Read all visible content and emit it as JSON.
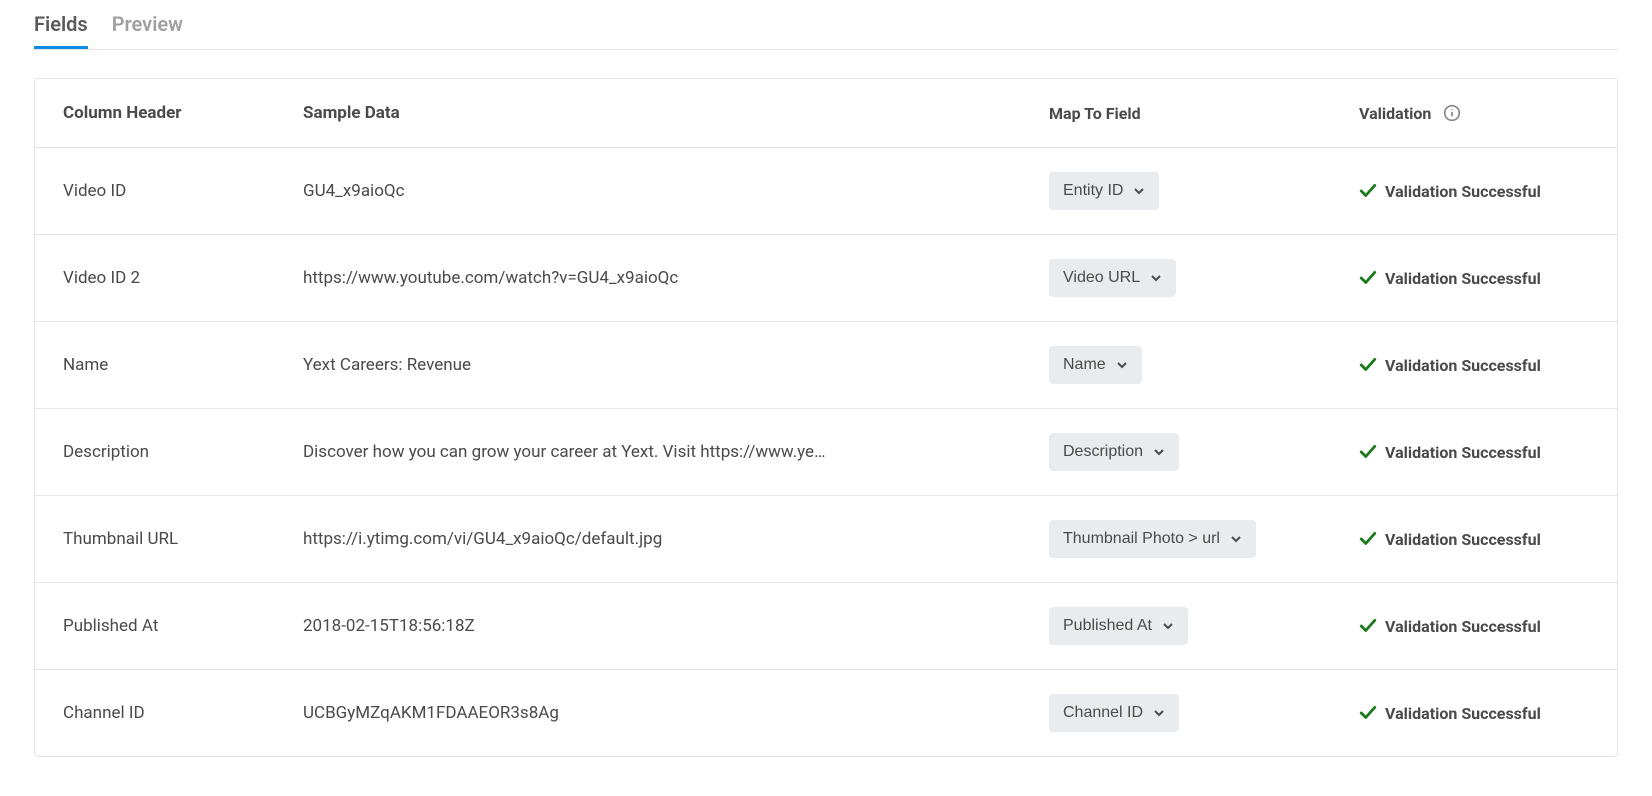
{
  "tabs": [
    {
      "label": "Fields",
      "active": true
    },
    {
      "label": "Preview",
      "active": false
    }
  ],
  "headers": {
    "column_header": "Column Header",
    "sample_data": "Sample Data",
    "map_to_field": "Map To Field",
    "validation": "Validation"
  },
  "rows": [
    {
      "column": "Video ID",
      "sample": "GU4_x9aioQc",
      "map": "Entity ID",
      "validation": "Validation Successful"
    },
    {
      "column": "Video ID 2",
      "sample": "https://www.youtube.com/watch?v=GU4_x9aioQc",
      "map": "Video URL",
      "validation": "Validation Successful"
    },
    {
      "column": "Name",
      "sample": "Yext Careers: Revenue",
      "map": "Name",
      "validation": "Validation Successful"
    },
    {
      "column": "Description",
      "sample": "Discover how you can grow your career at Yext. Visit https://www.ye…",
      "map": "Description",
      "validation": "Validation Successful"
    },
    {
      "column": "Thumbnail URL",
      "sample": "https://i.ytimg.com/vi/GU4_x9aioQc/default.jpg",
      "map": "Thumbnail Photo > url",
      "validation": "Validation Successful"
    },
    {
      "column": "Published At",
      "sample": "2018-02-15T18:56:18Z",
      "map": "Published At",
      "validation": "Validation Successful"
    },
    {
      "column": "Channel ID",
      "sample": "UCBGyMZqAKM1FDAAEOR3s8Ag",
      "map": "Channel ID",
      "validation": "Validation Successful"
    }
  ]
}
